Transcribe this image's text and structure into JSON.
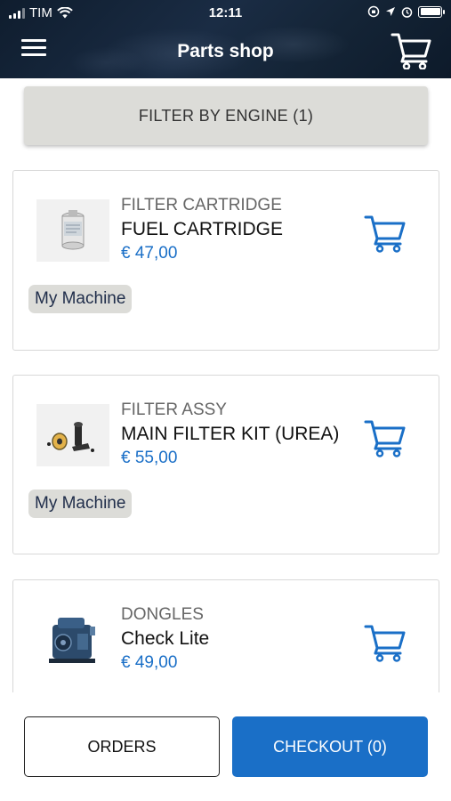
{
  "status_bar": {
    "carrier": "TIM",
    "time": "12:11"
  },
  "header": {
    "title": "Parts shop",
    "menu_icon": "hamburger-menu-icon",
    "cart_icon": "shopping-cart-icon"
  },
  "filter": {
    "label": "FILTER BY ENGINE (1)"
  },
  "products": [
    {
      "category": "FILTER CARTRIDGE",
      "name": "FUEL CARTRIDGE",
      "price": "€ 47,00",
      "badge": "My Machine",
      "image": "fuel-cartridge-image"
    },
    {
      "category": "FILTER ASSY",
      "name": "MAIN FILTER KIT (UREA)",
      "price": "€ 55,00",
      "badge": "My Machine",
      "image": "filter-kit-image"
    },
    {
      "category": "DONGLES",
      "name": "Check Lite",
      "price": "€ 49,00",
      "image": "engine-image"
    }
  ],
  "footer": {
    "orders_label": "ORDERS",
    "checkout_label": "CHECKOUT (0)"
  },
  "colors": {
    "accent": "#1a6fc7",
    "header_bg": "#14243a",
    "filter_bg": "#dcdcd8"
  }
}
